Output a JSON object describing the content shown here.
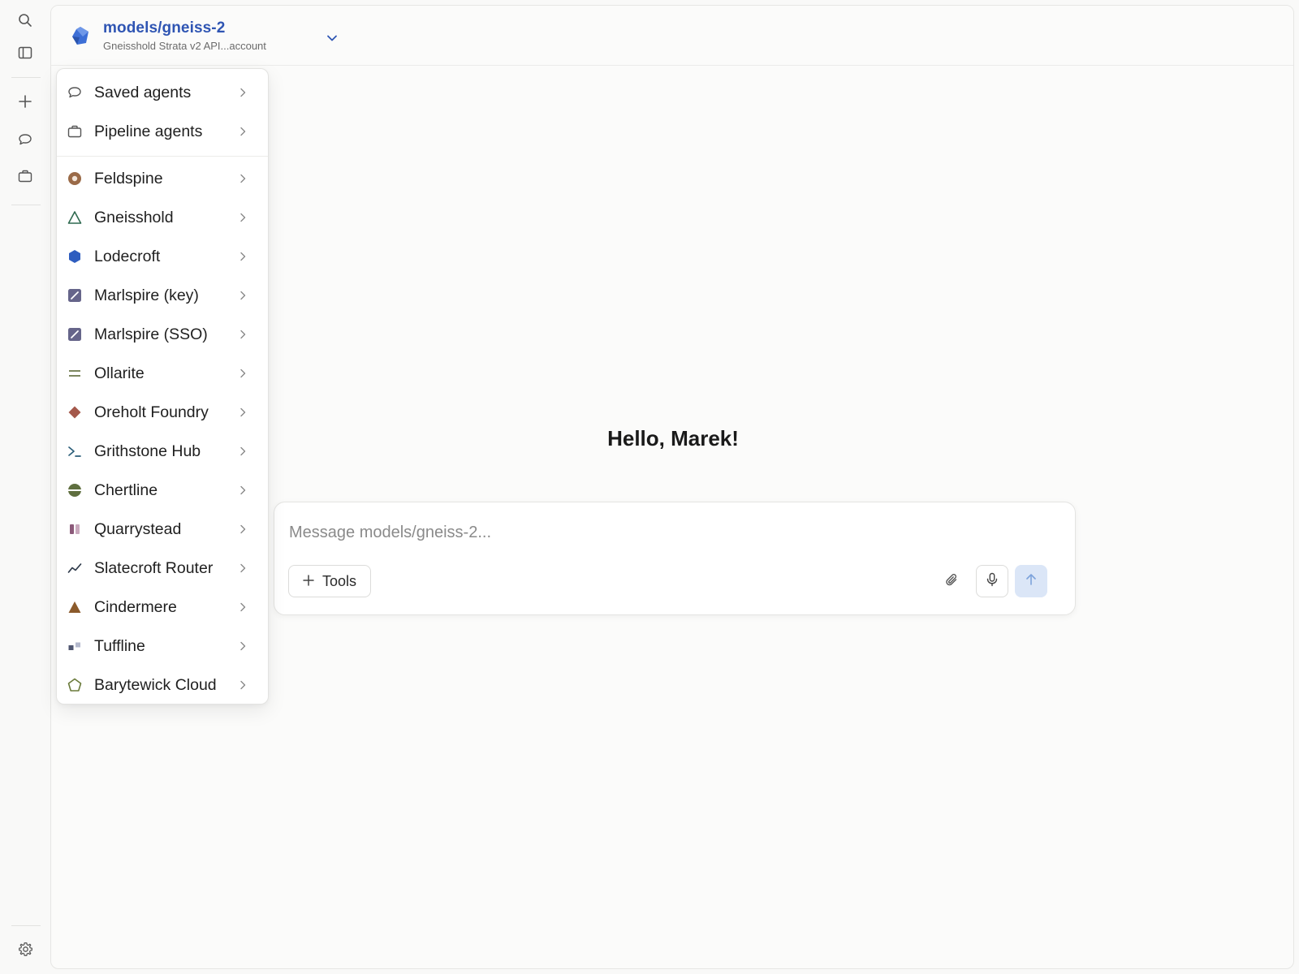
{
  "model": {
    "name": "models/gneiss-2",
    "subtitle": "Gneisshold Strata v2 API...account"
  },
  "rail": {
    "icons": [
      "search-icon",
      "sidebar-toggle-icon",
      "plus-icon",
      "chat-bubble-icon",
      "briefcase-icon",
      "gear-icon"
    ]
  },
  "dropdown": {
    "sections": [
      {
        "label": "Saved agents",
        "icon": "chat-bubble-icon"
      },
      {
        "label": "Pipeline agents",
        "icon": "briefcase-icon"
      }
    ],
    "providers": [
      {
        "label": "Feldspine",
        "icon": "ring-dot-icon",
        "color": "#9a6a47"
      },
      {
        "label": "Gneisshold",
        "icon": "triangle-outline-icon",
        "color": "#2f6a50"
      },
      {
        "label": "Lodecroft",
        "icon": "hexagon-icon",
        "color": "#2e5dbf"
      },
      {
        "label": "Marlspire (key)",
        "icon": "slash-square-icon",
        "color": "#66658a"
      },
      {
        "label": "Marlspire (SSO)",
        "icon": "slash-square-icon",
        "color": "#66658a"
      },
      {
        "label": "Ollarite",
        "icon": "equals-icon",
        "color": "#6f7a4f"
      },
      {
        "label": "Oreholt Foundry",
        "icon": "diamond-icon",
        "color": "#a4584b"
      },
      {
        "label": "Grithstone Hub",
        "icon": "terminal-icon",
        "color": "#2b5e79"
      },
      {
        "label": "Chertline",
        "icon": "split-circle-icon",
        "color": "#5f6f3f"
      },
      {
        "label": "Quarrystead",
        "icon": "double-bar-icon",
        "color": "#8c5a7a"
      },
      {
        "label": "Slatecroft Router",
        "icon": "trend-line-icon",
        "color": "#2e3a4a"
      },
      {
        "label": "Cindermere",
        "icon": "triangle-filled-icon",
        "color": "#8b5a2b"
      },
      {
        "label": "Tuffline",
        "icon": "squares-icon",
        "color": "#4f5670"
      },
      {
        "label": "Barytewick Cloud",
        "icon": "pentagon-icon",
        "color": "#6a7a3a"
      }
    ]
  },
  "greeting": "Hello, Marek!",
  "composer": {
    "placeholder": "Message models/gneiss-2...",
    "tools_label": "Tools"
  },
  "colors": {
    "accent": "#2f55b3",
    "send_bg": "#dbe6f7"
  }
}
